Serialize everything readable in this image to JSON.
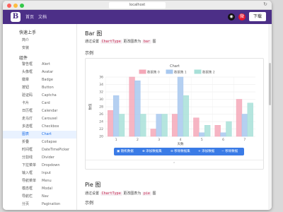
{
  "browser": {
    "url": "localhost",
    "reload_glyph": "↻"
  },
  "navbar": {
    "logo_letter": "B",
    "links": [
      "首页",
      "文档"
    ],
    "github_glyph": "◉",
    "weibo_glyph": "微",
    "download_label": "下载",
    "brand_color": "#4c2f87"
  },
  "sidebar": {
    "group1": "快速上手",
    "group1_items": [
      {
        "cn": "简介",
        "en": ""
      },
      {
        "cn": "安装",
        "en": ""
      }
    ],
    "group2": "组件",
    "group2_items": [
      {
        "cn": "警告框",
        "en": "Alert"
      },
      {
        "cn": "头像框",
        "en": "Avatar"
      },
      {
        "cn": "徽章",
        "en": "Badge"
      },
      {
        "cn": "按钮",
        "en": "Button"
      },
      {
        "cn": "验证码",
        "en": "Captcha"
      },
      {
        "cn": "卡片",
        "en": "Card"
      },
      {
        "cn": "日历框",
        "en": "Calendar"
      },
      {
        "cn": "走马灯",
        "en": "Carousel"
      },
      {
        "cn": "多选框",
        "en": "Checkbox"
      },
      {
        "cn": "图表",
        "en": "Chart"
      },
      {
        "cn": "折叠",
        "en": "Collapse"
      },
      {
        "cn": "时间框",
        "en": "DateTimePicker"
      },
      {
        "cn": "分割线",
        "en": "Divider"
      },
      {
        "cn": "下拉菜单",
        "en": "Dropdown"
      },
      {
        "cn": "输入框",
        "en": "Input"
      },
      {
        "cn": "导航菜单",
        "en": "Menu"
      },
      {
        "cn": "模态框",
        "en": "Modal"
      },
      {
        "cn": "导航栏",
        "en": "Nav"
      },
      {
        "cn": "分页",
        "en": "Pagination"
      }
    ],
    "active_index": 9,
    "active_color": "#1e6fe8"
  },
  "main": {
    "bar_title": "Bar 图",
    "bar_desc_prefix": "通过设置",
    "bar_desc_code": "ChartType",
    "bar_desc_mid": "更改图表为",
    "bar_desc_code2": "bar",
    "bar_desc_suffix": "图",
    "example_label": "示例",
    "pie_title": "Pie 图",
    "pie_desc_prefix": "通过设置",
    "pie_desc_code": "ChartType",
    "pie_desc_mid": "更改图表为",
    "pie_desc_code2": "pie",
    "pie_desc_suffix": "图",
    "example_label2": "示例",
    "buttons": [
      {
        "icon": "▣",
        "label": "随机数据"
      },
      {
        "icon": "⊕",
        "label": "添加数据集"
      },
      {
        "icon": "⊖",
        "label": "移除数据集"
      },
      {
        "icon": "+",
        "label": "添加数据"
      },
      {
        "icon": "−",
        "label": "移除数据"
      }
    ],
    "button_color": "#3a7be6",
    "caret": "⌃"
  },
  "chart_data": {
    "type": "bar",
    "title": "Chart",
    "xlabel": "天数",
    "ylabel": "数值",
    "categories": [
      "1",
      "2",
      "3",
      "4",
      "5",
      "6",
      "7"
    ],
    "series": [
      {
        "name": "数据集 0",
        "color": "#f4a8b8",
        "values": [
          27,
          36,
          22,
          26,
          25,
          23,
          30
        ]
      },
      {
        "name": "数据集 1",
        "color": "#a8c8ef",
        "values": [
          31,
          35,
          26,
          36,
          21,
          21,
          26
        ]
      },
      {
        "name": "数据集 2",
        "color": "#a8e0d8",
        "values": [
          26,
          26,
          26,
          31,
          23,
          24,
          29
        ]
      }
    ],
    "ylim": [
      20,
      36
    ],
    "yticks": [
      20,
      22,
      24,
      26,
      28,
      30,
      32,
      34,
      36
    ],
    "grid": true,
    "legend": "top-center"
  }
}
